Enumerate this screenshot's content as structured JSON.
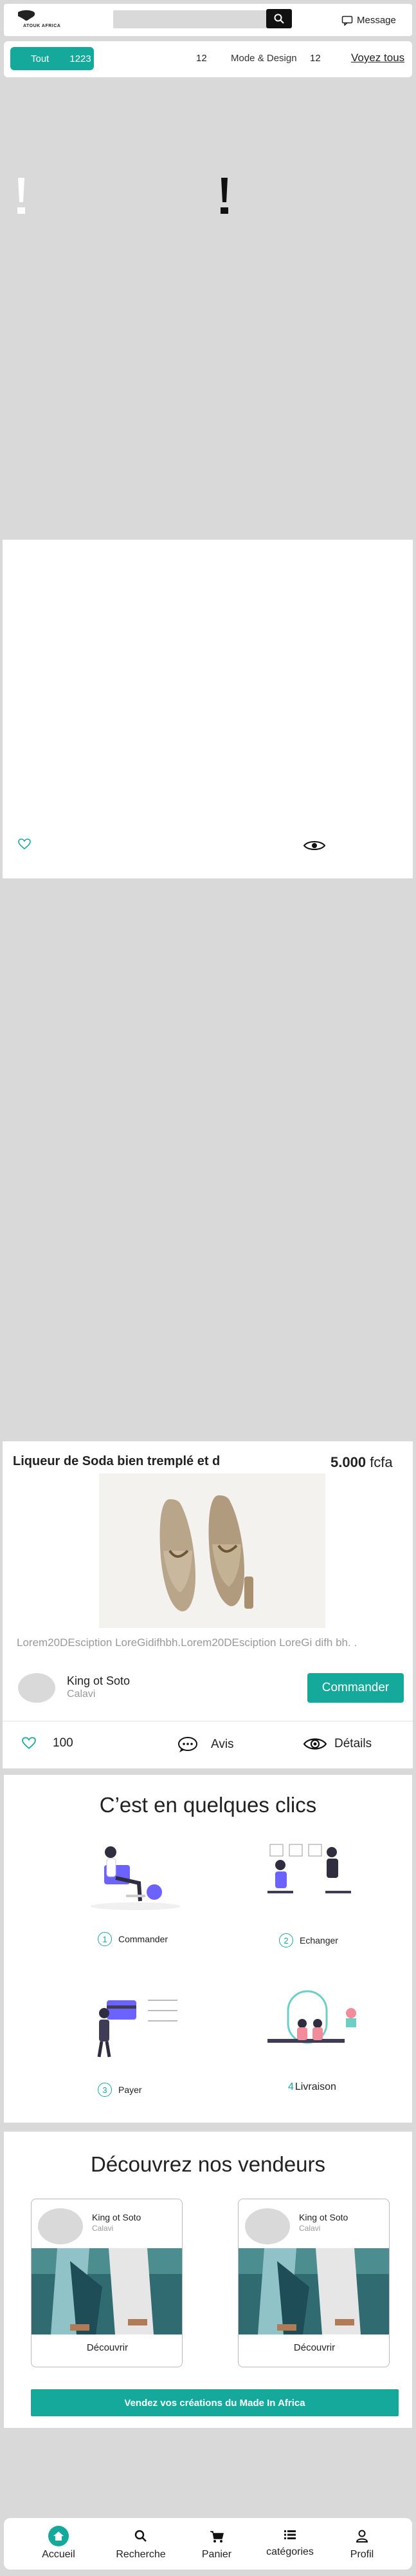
{
  "header": {
    "logo_text": "ATOUK AFRICA",
    "search_placeholder": "",
    "message_label": "Message"
  },
  "filters": {
    "all_label": "Tout",
    "all_count": "1223",
    "count_a": "12",
    "category_label": "Mode & Design",
    "category_count": "12",
    "see_all": "Voyez tous"
  },
  "product": {
    "title": "Liqueur de Soda bien tremplé et d",
    "price_value": "5.000",
    "price_currency": "fcfa",
    "description": "Lorem20DEsciption LoreGidifhbh.Lorem20DEsciption LoreGi difh bh. .",
    "seller_name": "King ot Soto",
    "seller_city": "Calavi",
    "order_button": "Commander",
    "likes": "100",
    "reviews_label": "Avis",
    "details_label": "Détails"
  },
  "steps": {
    "title": "C’est en quelques clics",
    "items": [
      {
        "num": "1",
        "label": "Commander"
      },
      {
        "num": "2",
        "label": "Echanger"
      },
      {
        "num": "3",
        "label": "Payer"
      },
      {
        "num": "4",
        "label": "Livraison"
      }
    ]
  },
  "vendors": {
    "title": "Découvrez  nos vendeurs",
    "cards": [
      {
        "name": "King ot Soto",
        "city": "Calavi",
        "button": "Découvrir"
      },
      {
        "name": "King ot Soto",
        "city": "Calavi",
        "button": "Découvrir"
      }
    ],
    "cta": "Vendez vos créations du Made In Africa"
  },
  "bottom_nav": {
    "items": [
      {
        "label": "Accueil",
        "icon": "home-icon"
      },
      {
        "label": "Recherche",
        "icon": "search-icon"
      },
      {
        "label": "Panier",
        "icon": "cart-icon"
      },
      {
        "label": "catégories",
        "icon": "menu-icon"
      },
      {
        "label": "Profil",
        "icon": "user-icon"
      }
    ]
  },
  "colors": {
    "accent": "#14a99b",
    "page_bg": "#d9d9d9"
  }
}
